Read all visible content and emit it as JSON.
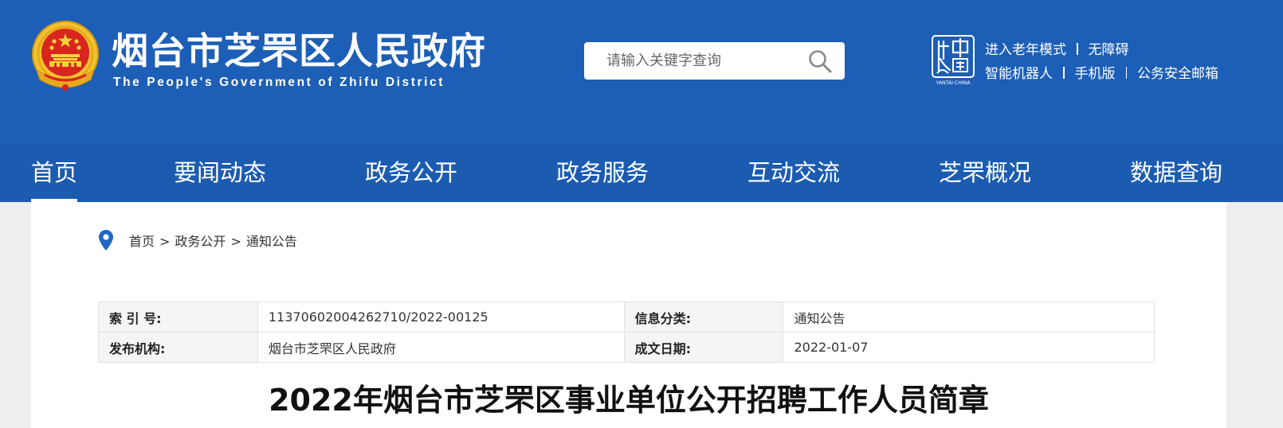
{
  "header": {
    "title": "烟台市芝罘区人民政府",
    "subtitle": "The People's Government of Zhifu District",
    "search": {
      "placeholder": "请输入关键字查询",
      "value": ""
    },
    "logo": {
      "icon": "yantai-city-seal-icon",
      "text": "烟台中国 YANTAI·CHINA"
    },
    "links": {
      "elderly_mode": "进入老年模式",
      "accessibility": "无障碍",
      "robot": "智能机器人",
      "mobile": "手机版",
      "mailbox": "公务安全邮箱"
    },
    "colors": {
      "brand_blue": "#1d5fb6"
    }
  },
  "nav": {
    "items": [
      {
        "label": "首页",
        "active": true
      },
      {
        "label": "要闻动态"
      },
      {
        "label": "政务公开"
      },
      {
        "label": "政务服务"
      },
      {
        "label": "互动交流"
      },
      {
        "label": "芝罘概况"
      },
      {
        "label": "数据查询"
      }
    ]
  },
  "breadcrumb": {
    "icon": "location-pin-icon",
    "items": [
      "首页",
      "政务公开",
      "通知公告"
    ],
    "separator": ">"
  },
  "meta": {
    "index_label": "索 引 号:",
    "index_value": "11370602004262710/2022-00125",
    "category_label": "信息分类:",
    "category_value": "通知公告",
    "publisher_label": "发布机构:",
    "publisher_value": "烟台市芝罘区人民政府",
    "date_label": "成文日期:",
    "date_value": "2022-01-07"
  },
  "article": {
    "title": "2022年烟台市芝罘区事业单位公开招聘工作人员简章"
  }
}
